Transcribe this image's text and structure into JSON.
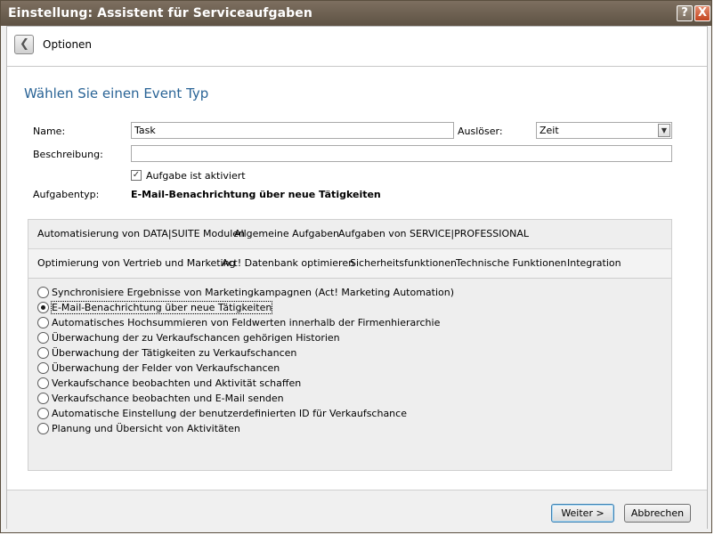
{
  "window": {
    "title": "Einstellung: Assistent für Serviceaufgaben",
    "help_symbol": "?",
    "close_symbol": "X"
  },
  "nav": {
    "back_icon": "chevron-left-icon",
    "title": "Optionen"
  },
  "heading": "Wählen Sie einen Event Typ",
  "form": {
    "name_label": "Name:",
    "name_value": "Task",
    "trigger_label": "Auslöser:",
    "trigger_value": "Zeit",
    "description_label": "Beschreibung:",
    "description_value": "",
    "active_checkbox_label": "Aufgabe ist aktiviert",
    "active_checked": true,
    "tasktype_label": "Aufgabentyp:",
    "tasktype_value": "E-Mail-Benachrichtung über neue Tätigkeiten"
  },
  "tabs_row1": [
    "Automatisierung von DATA|SUITE Modulen",
    "Allgemeine Aufgaben",
    "Aufgaben von SERVICE|PROFESSIONAL"
  ],
  "tabs_row2": [
    "Optimierung von Vertrieb und Marketing",
    "Act! Datenbank optimieren",
    "Sicherheitsfunktionen",
    "Technische Funktionen",
    "Integration"
  ],
  "options": [
    "Synchronisiere Ergebnisse von Marketingkampagnen (Act! Marketing Automation)",
    "E-Mail-Benachrichtung über neue Tätigkeiten",
    "Automatisches Hochsummieren von Feldwerten innerhalb der Firmenhierarchie",
    "Überwachung der zu Verkaufschancen gehörigen Historien",
    "Überwachung der Tätigkeiten zu Verkaufschancen",
    "Überwachung der Felder von Verkaufschancen",
    "Verkaufschance beobachten und Aktivität schaffen",
    "Verkaufschance beobachten und E-Mail senden",
    "Automatische Einstellung der benutzerdefinierten ID für Verkaufschance",
    "Planung und Übersicht von Aktivitäten"
  ],
  "selected_option_index": 1,
  "footer": {
    "next_label": "Weiter >",
    "cancel_label": "Abbrechen"
  },
  "colors": {
    "titlebar": "#5e5244",
    "heading": "#2a6496",
    "close_button": "#c3441f"
  }
}
